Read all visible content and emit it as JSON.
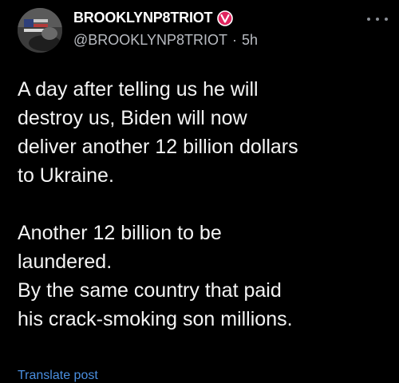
{
  "post": {
    "display_name": "BROOKLYNP8TRIOT",
    "handle": "@BROOKLYNP8TRIOT",
    "separator": "·",
    "timestamp": "5h",
    "paragraph_1": [
      "A day after telling us he will",
      "destroy us, Biden will now",
      "deliver another 12 billion dollars",
      "to Ukraine."
    ],
    "paragraph_2": [
      "Another 12 billion to be",
      "laundered.",
      "By the same country that paid",
      "his crack-smoking son millions."
    ],
    "translate_label": "Translate post"
  },
  "icons": {
    "verified": "verified-badge-icon",
    "more": "more-options-icon"
  },
  "colors": {
    "background": "#000000",
    "text": "#f4f4f4",
    "secondary_text": "#b9bcc2",
    "verified_badge": "#e0245e",
    "link": "#4a8fe0"
  }
}
